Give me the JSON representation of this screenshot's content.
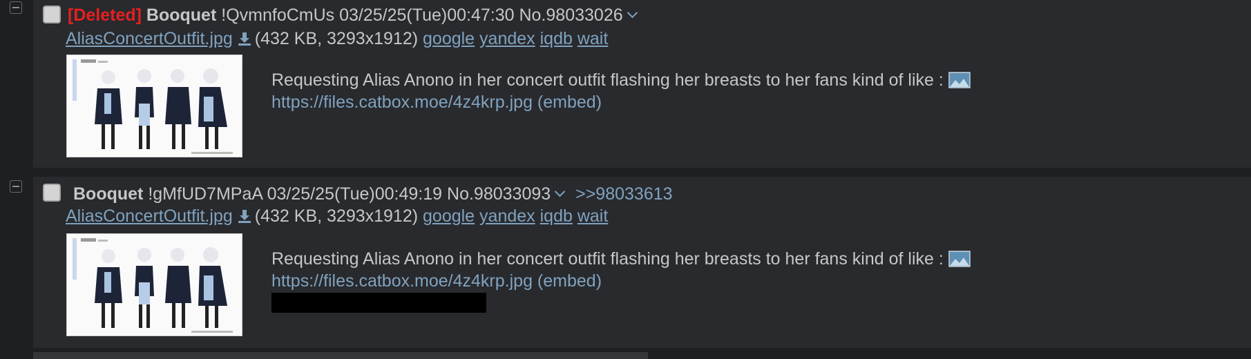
{
  "posts": [
    {
      "deleted_tag": "[Deleted]",
      "name": "Booquet",
      "tripcode": "!QvmnfoCmUs",
      "datetime": "03/25/25(Tue)00:47:30",
      "post_no": "No.98033026",
      "backlink": "",
      "filename": "AliasConcertOutfit.jpg",
      "file_meta": "(432 KB, 3293x1912)",
      "search_links": [
        "google",
        "yandex",
        "iqdb",
        "wait"
      ],
      "comment_text": "Requesting Alias Anono in her concert outfit flashing her breasts to her fans kind of like :",
      "embed_link": "https://files.catbox.moe/4z4krp.jpg",
      "embed_label": "(embed)",
      "redacted": false
    },
    {
      "deleted_tag": "",
      "name": "Booquet",
      "tripcode": "!gMfUD7MPaA",
      "datetime": "03/25/25(Tue)00:49:19",
      "post_no": "No.98033093",
      "backlink": ">>98033613",
      "filename": "AliasConcertOutfit.jpg",
      "file_meta": "(432 KB, 3293x1912)",
      "search_links": [
        "google",
        "yandex",
        "iqdb",
        "wait"
      ],
      "comment_text": "Requesting Alias Anono in her concert outfit flashing her breasts to her fans kind of like :",
      "embed_link": "https://files.catbox.moe/4z4krp.jpg",
      "embed_label": "(embed)",
      "redacted": true
    }
  ],
  "colors": {
    "background": "#1d1f21",
    "post_background": "#282a2e",
    "text": "#c5c8c6",
    "link": "#81a2be",
    "deleted": "#e62020"
  },
  "icons": {
    "collapse": "minus-square-icon",
    "expand_menu": "chevron-down-icon",
    "download": "download-icon",
    "embed_image": "image-icon"
  }
}
